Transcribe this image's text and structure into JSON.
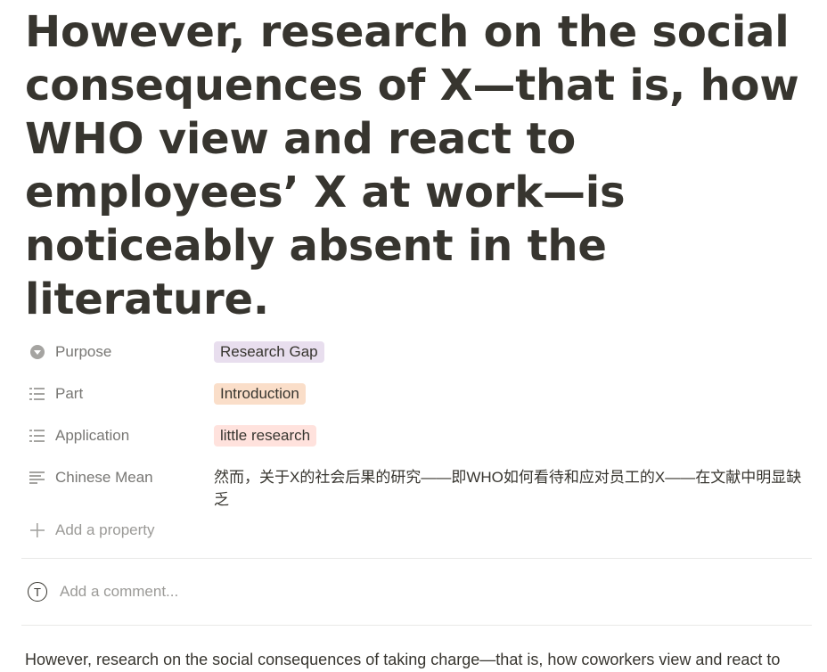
{
  "title": "However, research on the social consequences of X—that is, how WHO view and react to employees’ X at work—is noticeably absent in the literature.",
  "properties": [
    {
      "name": "Purpose",
      "icon": "circle-chevron-down-icon",
      "value": "Research Gap",
      "color": "#e8deee"
    },
    {
      "name": "Part",
      "icon": "list-icon",
      "value": "Introduction",
      "color": "#fadec9"
    },
    {
      "name": "Application",
      "icon": "list-icon",
      "value": "little research",
      "color": "#ffe2dd"
    },
    {
      "name": "Chinese Mean",
      "icon": "text-lines-icon",
      "value": "然而，关于X的社会后果的研究——即WHO如何看待和应对员工的X——在文献中明显缺乏"
    }
  ],
  "add_property_label": "Add a property",
  "comment": {
    "avatar_letter": "T",
    "placeholder": "Add a comment..."
  },
  "body": "However, research on the social consequences of taking charge—that is, how coworkers view and react to employees’ taking charge at work—is noticeably absent in the literature."
}
